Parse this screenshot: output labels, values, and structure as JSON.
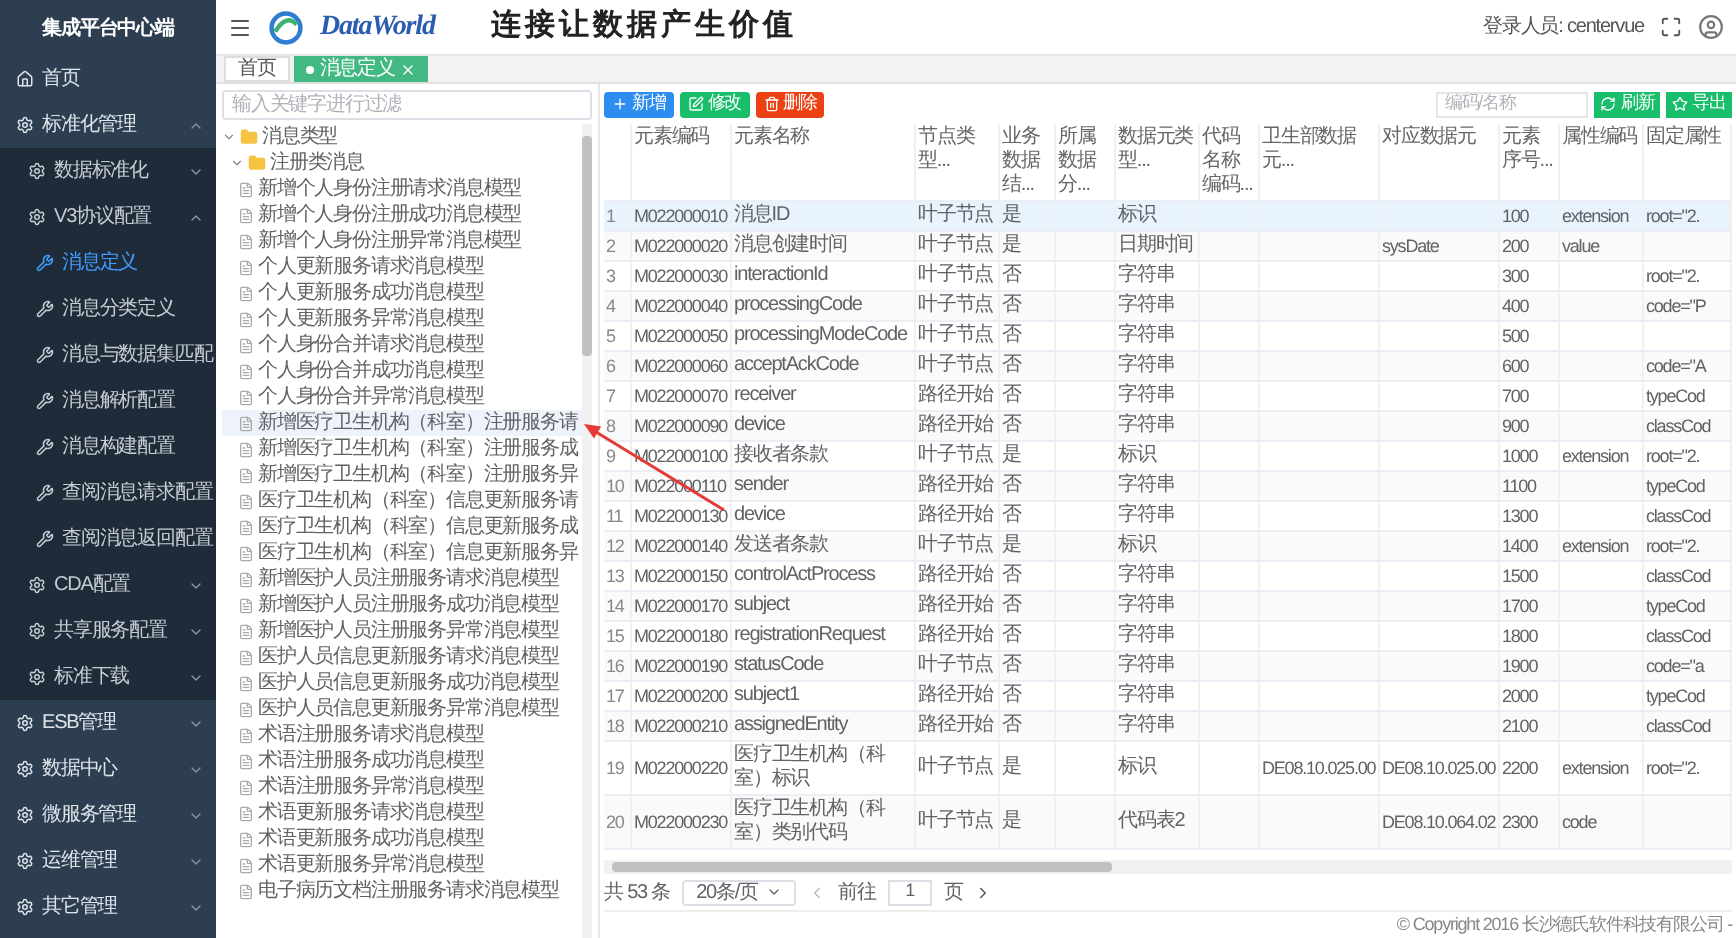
{
  "sidebar": {
    "title": "集成平台中心端",
    "items": [
      {
        "label": "首页",
        "kind": "home"
      },
      {
        "label": "标准化管理",
        "kind": "group",
        "expanded": true,
        "children": [
          {
            "label": "数据标准化",
            "kind": "group",
            "expanded": false
          },
          {
            "label": "V3协议配置",
            "kind": "group",
            "expanded": true,
            "children": [
              {
                "label": "消息定义",
                "kind": "tool",
                "selected": true
              },
              {
                "label": "消息分类定义",
                "kind": "tool",
                "selected": false
              },
              {
                "label": "消息与数据集匹配",
                "kind": "tool",
                "selected": false
              },
              {
                "label": "消息解析配置",
                "kind": "tool",
                "selected": false
              },
              {
                "label": "消息构建配置",
                "kind": "tool",
                "selected": false
              },
              {
                "label": "查阅消息请求配置",
                "kind": "tool",
                "selected": false
              },
              {
                "label": "查阅消息返回配置",
                "kind": "tool",
                "selected": false
              }
            ]
          },
          {
            "label": "CDA配置",
            "kind": "group",
            "expanded": false
          },
          {
            "label": "共享服务配置",
            "kind": "group",
            "expanded": false
          },
          {
            "label": "标准下载",
            "kind": "group",
            "expanded": false
          }
        ]
      },
      {
        "label": "ESB管理",
        "kind": "group",
        "expanded": false
      },
      {
        "label": "数据中心",
        "kind": "group",
        "expanded": false
      },
      {
        "label": "微服务管理",
        "kind": "group",
        "expanded": false
      },
      {
        "label": "运维管理",
        "kind": "group",
        "expanded": false
      },
      {
        "label": "其它管理",
        "kind": "group",
        "expanded": false
      }
    ]
  },
  "header": {
    "logo": "DataWorld",
    "slogan": "连接让数据产生价值",
    "user": "登录人员: centervue"
  },
  "tabs": [
    {
      "label": "首页",
      "selected": false,
      "closable": false
    },
    {
      "label": "消息定义",
      "selected": true,
      "closable": true
    }
  ],
  "tree": {
    "placeholder": "输入关键字进行过滤",
    "nodes": [
      {
        "label": "消息类型",
        "expanded": true,
        "children": [
          {
            "label": "注册类消息",
            "expanded": true,
            "children": [
              {
                "label": "新增个人身份注册请求消息模型",
                "selected": false
              },
              {
                "label": "新增个人身份注册成功消息模型",
                "selected": false
              },
              {
                "label": "新增个人身份注册异常消息模型",
                "selected": false
              },
              {
                "label": "个人更新服务请求消息模型",
                "selected": false
              },
              {
                "label": "个人更新服务成功消息模型",
                "selected": false
              },
              {
                "label": "个人更新服务异常消息模型",
                "selected": false
              },
              {
                "label": "个人身份合并请求消息模型",
                "selected": false
              },
              {
                "label": "个人身份合并成功消息模型",
                "selected": false
              },
              {
                "label": "个人身份合并异常消息模型",
                "selected": false
              },
              {
                "label": "新增医疗卫生机构（科室）注册服务请",
                "selected": true
              },
              {
                "label": "新增医疗卫生机构（科室）注册服务成",
                "selected": false
              },
              {
                "label": "新增医疗卫生机构（科室）注册服务异",
                "selected": false
              },
              {
                "label": "医疗卫生机构（科室）信息更新服务请",
                "selected": false
              },
              {
                "label": "医疗卫生机构（科室）信息更新服务成",
                "selected": false
              },
              {
                "label": "医疗卫生机构（科室）信息更新服务异",
                "selected": false
              },
              {
                "label": "新增医护人员注册服务请求消息模型",
                "selected": false
              },
              {
                "label": "新增医护人员注册服务成功消息模型",
                "selected": false
              },
              {
                "label": "新增医护人员注册服务异常消息模型",
                "selected": false
              },
              {
                "label": "医护人员信息更新服务请求消息模型",
                "selected": false
              },
              {
                "label": "医护人员信息更新服务成功消息模型",
                "selected": false
              },
              {
                "label": "医护人员信息更新服务异常消息模型",
                "selected": false
              },
              {
                "label": "术语注册服务请求消息模型",
                "selected": false
              },
              {
                "label": "术语注册服务成功消息模型",
                "selected": false
              },
              {
                "label": "术语注册服务异常消息模型",
                "selected": false
              },
              {
                "label": "术语更新服务请求消息模型",
                "selected": false
              },
              {
                "label": "术语更新服务成功消息模型",
                "selected": false
              },
              {
                "label": "术语更新服务异常消息模型",
                "selected": false
              },
              {
                "label": "电子病历文档注册服务请求消息模型",
                "selected": false
              }
            ]
          }
        ]
      }
    ]
  },
  "toolbar": {
    "buttons": [
      {
        "label": "新增",
        "kind": "add"
      },
      {
        "label": "修改",
        "kind": "edit"
      },
      {
        "label": "删除",
        "kind": "delete"
      }
    ],
    "search": {
      "placeholder": "编码/名称"
    },
    "actions": [
      {
        "label": "刷新",
        "kind": "refresh"
      },
      {
        "label": "导出",
        "kind": "export"
      }
    ]
  },
  "table": {
    "columns": [
      "元素编码",
      "元素名称",
      "节点类型...",
      "业务数据结...",
      "所属数据分...",
      "数据元类型...",
      "代码名称编码...",
      "卫生部数据元...",
      "对应数据元",
      "元素序号...",
      "属性编码",
      "固定属性"
    ],
    "rows": [
      {
        "index": "1",
        "selected": true,
        "cells": [
          "M022000010",
          "消息ID",
          "叶子节点",
          "是",
          null,
          "标识",
          null,
          null,
          null,
          "100",
          "extension",
          "root=\"2."
        ]
      },
      {
        "index": "2",
        "selected": false,
        "cells": [
          "M022000020",
          "消息创建时间",
          "叶子节点",
          "是",
          null,
          "日期时间",
          null,
          null,
          "sysDate",
          "200",
          "value",
          null
        ]
      },
      {
        "index": "3",
        "selected": false,
        "cells": [
          "M022000030",
          "interactionId",
          "叶子节点",
          "否",
          null,
          "字符串",
          null,
          null,
          null,
          "300",
          null,
          "root=\"2."
        ]
      },
      {
        "index": "4",
        "selected": false,
        "cells": [
          "M022000040",
          "processingCode",
          "叶子节点",
          "否",
          null,
          "字符串",
          null,
          null,
          null,
          "400",
          null,
          "code=\"P"
        ]
      },
      {
        "index": "5",
        "selected": false,
        "cells": [
          "M022000050",
          "processingModeCode",
          "叶子节点",
          "否",
          null,
          "字符串",
          null,
          null,
          null,
          "500",
          null,
          null
        ]
      },
      {
        "index": "6",
        "selected": false,
        "cells": [
          "M022000060",
          "acceptAckCode",
          "叶子节点",
          "否",
          null,
          "字符串",
          null,
          null,
          null,
          "600",
          null,
          "code=\"A"
        ]
      },
      {
        "index": "7",
        "selected": false,
        "cells": [
          "M022000070",
          "receiver",
          "路径开始",
          "否",
          null,
          "字符串",
          null,
          null,
          null,
          "700",
          null,
          "typeCod"
        ]
      },
      {
        "index": "8",
        "selected": false,
        "cells": [
          "M022000090",
          "device",
          "路径开始",
          "否",
          null,
          "字符串",
          null,
          null,
          null,
          "900",
          null,
          "classCod"
        ]
      },
      {
        "index": "9",
        "selected": false,
        "cells": [
          "M022000100",
          "接收者条款",
          "叶子节点",
          "是",
          null,
          "标识",
          null,
          null,
          null,
          "1000",
          "extension",
          "root=\"2."
        ]
      },
      {
        "index": "10",
        "selected": false,
        "cells": [
          "M022000110",
          "sender",
          "路径开始",
          "否",
          null,
          "字符串",
          null,
          null,
          null,
          "1100",
          null,
          "typeCod"
        ]
      },
      {
        "index": "11",
        "selected": false,
        "cells": [
          "M022000130",
          "device",
          "路径开始",
          "否",
          null,
          "字符串",
          null,
          null,
          null,
          "1300",
          null,
          "classCod"
        ]
      },
      {
        "index": "12",
        "selected": false,
        "cells": [
          "M022000140",
          "发送者条款",
          "叶子节点",
          "是",
          null,
          "标识",
          null,
          null,
          null,
          "1400",
          "extension",
          "root=\"2."
        ]
      },
      {
        "index": "13",
        "selected": false,
        "cells": [
          "M022000150",
          "controlActProcess",
          "路径开始",
          "否",
          null,
          "字符串",
          null,
          null,
          null,
          "1500",
          null,
          "classCod"
        ]
      },
      {
        "index": "14",
        "selected": false,
        "cells": [
          "M022000170",
          "subject",
          "路径开始",
          "否",
          null,
          "字符串",
          null,
          null,
          null,
          "1700",
          null,
          "typeCod"
        ]
      },
      {
        "index": "15",
        "selected": false,
        "cells": [
          "M022000180",
          "registrationRequest",
          "路径开始",
          "否",
          null,
          "字符串",
          null,
          null,
          null,
          "1800",
          null,
          "classCod"
        ]
      },
      {
        "index": "16",
        "selected": false,
        "cells": [
          "M022000190",
          "statusCode",
          "叶子节点",
          "否",
          null,
          "字符串",
          null,
          null,
          null,
          "1900",
          null,
          "code=\"a"
        ]
      },
      {
        "index": "17",
        "selected": false,
        "cells": [
          "M022000200",
          "subject1",
          "路径开始",
          "否",
          null,
          "字符串",
          null,
          null,
          null,
          "2000",
          null,
          "typeCod"
        ]
      },
      {
        "index": "18",
        "selected": false,
        "cells": [
          "M022000210",
          "assignedEntity",
          "路径开始",
          "否",
          null,
          "字符串",
          null,
          null,
          null,
          "2100",
          null,
          "classCod"
        ]
      },
      {
        "index": "19",
        "selected": false,
        "cells": [
          "M022000220",
          "医疗卫生机构（科室）标识",
          "叶子节点",
          "是",
          null,
          "标识",
          null,
          "DE08.10.025.00",
          "DE08.10.025.00",
          "2200",
          "extension",
          "root=\"2."
        ]
      },
      {
        "index": "20",
        "selected": false,
        "cells": [
          "M022000230",
          "医疗卫生机构（科室）类别代码",
          "叶子节点",
          "是",
          null,
          "代码表2",
          null,
          null,
          "DE08.10.064.02",
          "2300",
          "code",
          null
        ]
      }
    ]
  },
  "pagination": {
    "total": "共 53 条",
    "page_size": "20条/页",
    "goto": "前往",
    "page": "1",
    "unit": "页"
  },
  "footer": "© Copyright 2016 长沙德氏软件科技有限公司 -"
}
